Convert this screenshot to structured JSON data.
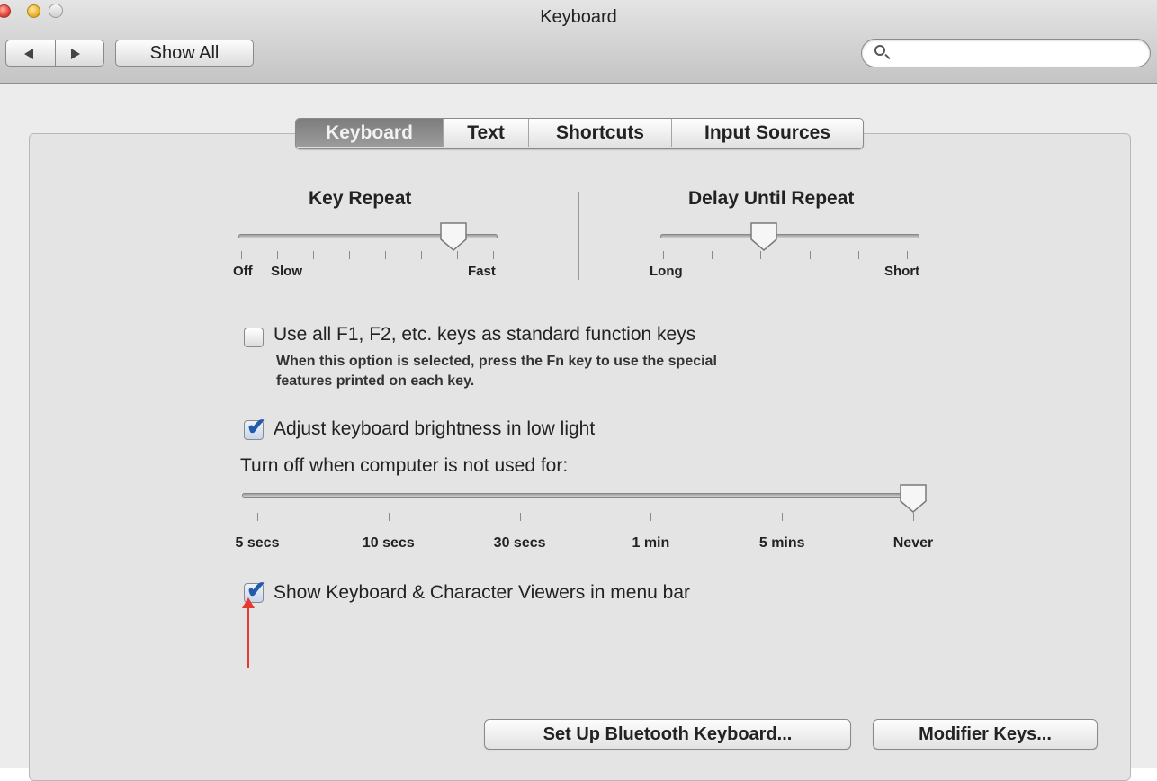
{
  "window": {
    "title": "Keyboard"
  },
  "toolbar": {
    "show_all_label": "Show All",
    "search_placeholder": "",
    "back_icon": "back-arrow-icon",
    "forward_icon": "forward-arrow-icon"
  },
  "tabs": [
    {
      "label": "Keyboard",
      "active": true
    },
    {
      "label": "Text",
      "active": false
    },
    {
      "label": "Shortcuts",
      "active": false
    },
    {
      "label": "Input Sources",
      "active": false
    }
  ],
  "key_repeat": {
    "title": "Key Repeat",
    "tick_labels": {
      "off": "Off",
      "slow": "Slow",
      "fast": "Fast"
    },
    "level_fraction": 0.83
  },
  "delay_until_repeat": {
    "title": "Delay Until Repeat",
    "tick_labels": {
      "long": "Long",
      "short": "Short"
    },
    "level_fraction": 0.4
  },
  "function_keys": {
    "label": "Use all F1, F2, etc. keys as standard function keys",
    "description_line1": "When this option is selected, press the Fn key to use the special",
    "description_line2": "features printed on each key.",
    "checked": false
  },
  "brightness": {
    "label": "Adjust keyboard brightness in low light",
    "checked": true
  },
  "turn_off": {
    "label": "Turn off when computer is not used for:",
    "ticks": [
      "5 secs",
      "10 secs",
      "30 secs",
      "1 min",
      "5 mins",
      "Never"
    ],
    "selected": "Never"
  },
  "viewers": {
    "label": "Show Keyboard & Character Viewers in menu bar",
    "checked": true
  },
  "buttons": {
    "bluetooth": "Set Up Bluetooth Keyboard...",
    "modifier": "Modifier Keys..."
  },
  "colors": {
    "annotation_arrow": "#e53a2f",
    "checkmark": "#245aab"
  }
}
